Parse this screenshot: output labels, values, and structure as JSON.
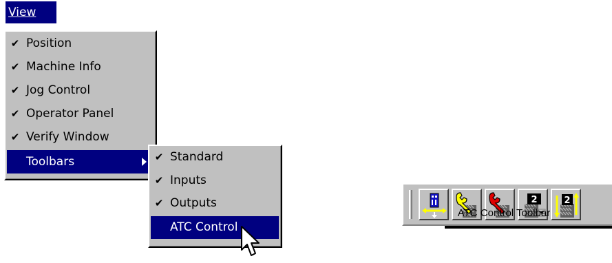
{
  "menu": {
    "title": "View",
    "items": [
      {
        "label": "Position",
        "checked": true
      },
      {
        "label": "Machine Info",
        "checked": true
      },
      {
        "label": "Jog Control",
        "checked": true
      },
      {
        "label": "Operator Panel",
        "checked": true
      },
      {
        "label": "Verify Window",
        "checked": true
      },
      {
        "label": "Toolbars",
        "checked": false,
        "has_submenu": true,
        "highlighted": true
      }
    ],
    "check_glyph": "✔"
  },
  "submenu": {
    "items": [
      {
        "label": "Standard",
        "checked": true
      },
      {
        "label": "Inputs",
        "checked": true
      },
      {
        "label": "Outputs",
        "checked": true
      },
      {
        "label": "ATC Control",
        "checked": false,
        "highlighted": true
      }
    ]
  },
  "toolbar": {
    "caption": "ATC Control Toolbar",
    "buttons": [
      {
        "icon": "tool-spindle-arrows-icon"
      },
      {
        "icon": "wrench-yellow-icon"
      },
      {
        "icon": "wrench-red-icon"
      },
      {
        "icon": "tool-number-dropdown-icon",
        "text": "2"
      },
      {
        "icon": "tool-number-swap-icon",
        "text": "2"
      }
    ]
  },
  "colors": {
    "highlight": "#000080",
    "menu_bg": "#c0c0c0",
    "icon_blue": "#0000c0",
    "icon_yellow": "#ffff00",
    "icon_red": "#e00000"
  }
}
